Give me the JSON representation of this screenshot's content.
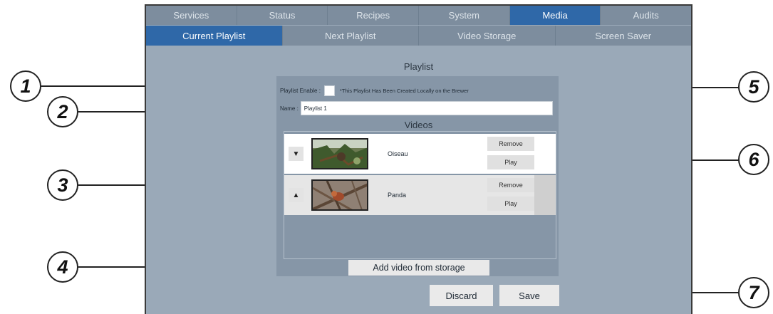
{
  "top_tabs": [
    "Services",
    "Status",
    "Recipes",
    "System",
    "Media",
    "Audits"
  ],
  "sub_tabs": [
    "Current Playlist",
    "Next Playlist",
    "Video Storage",
    "Screen Saver"
  ],
  "playlist_title": "Playlist",
  "enable_label": "Playlist Enable :",
  "local_note": "*This Playlist Has Been Created Locally on the Brewer",
  "name_label": "Name :",
  "name_value": "Playlist 1",
  "videos_title": "Videos",
  "videos": [
    {
      "move": "▼",
      "name": "Oiseau",
      "remove": "Remove",
      "play": "Play"
    },
    {
      "move": "▲",
      "name": "Panda",
      "remove": "Remove",
      "play": "Play"
    }
  ],
  "add_video_label": "Add video from storage",
  "discard_label": "Discard",
  "save_label": "Save",
  "callouts": [
    "1",
    "2",
    "3",
    "4",
    "5",
    "6",
    "7"
  ],
  "colors": {
    "active_tab": "#2f68a8",
    "screen_bg": "#9aa9b8",
    "panel_bg": "#8696a7"
  }
}
